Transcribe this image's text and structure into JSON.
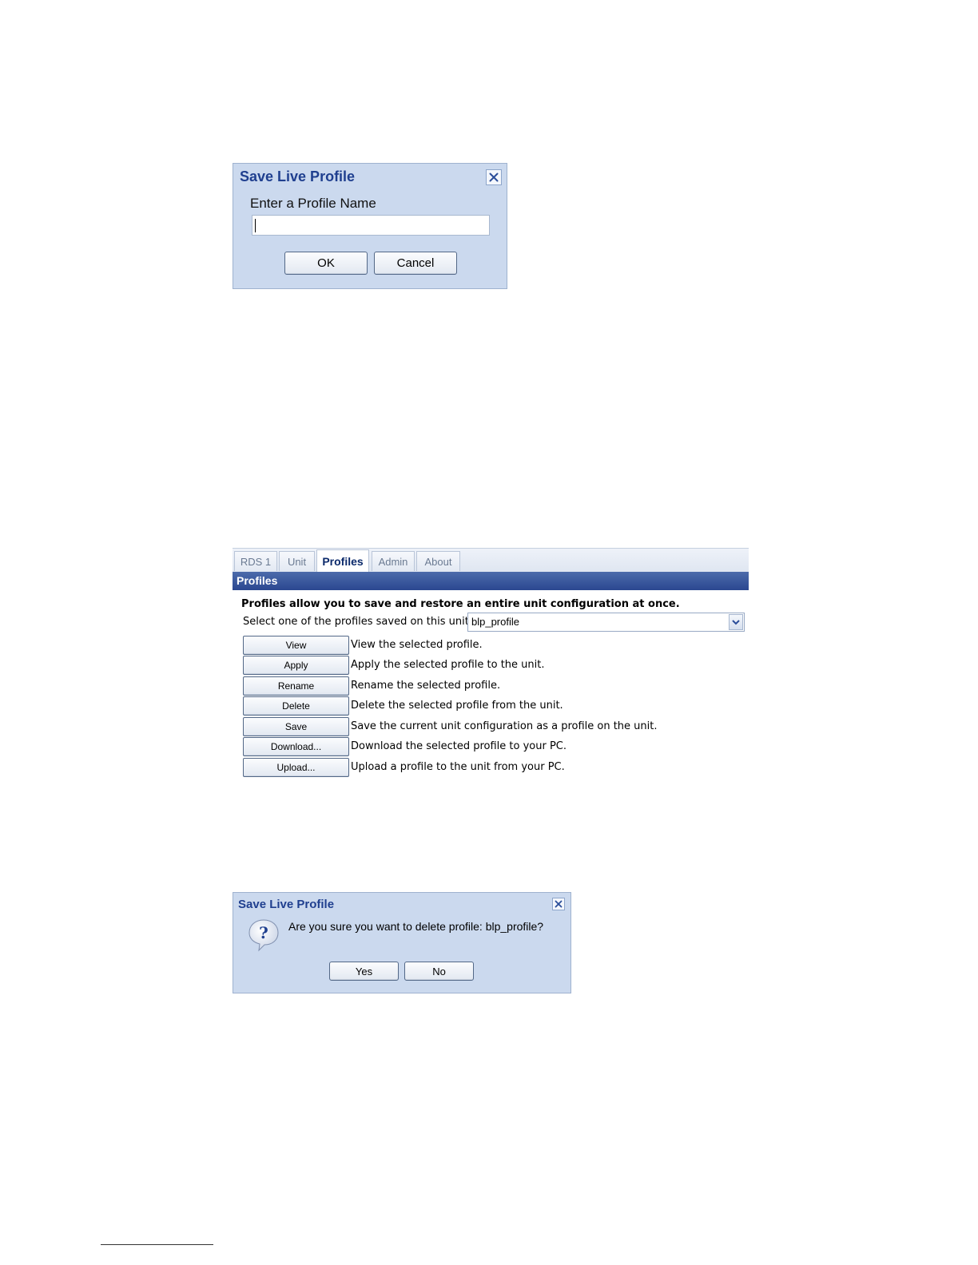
{
  "save_dialog": {
    "title": "Save Live Profile",
    "prompt": "Enter a Profile Name",
    "input_value": "",
    "ok_label": "OK",
    "cancel_label": "Cancel",
    "close_icon": "close-icon"
  },
  "profiles_panel": {
    "tabs": [
      {
        "label": "RDS 1",
        "active": false
      },
      {
        "label": "Unit",
        "active": false
      },
      {
        "label": "Profiles",
        "active": true
      },
      {
        "label": "Admin",
        "active": false
      },
      {
        "label": "About",
        "active": false
      }
    ],
    "header": "Profiles",
    "intro": "Profiles allow you to save and restore an entire unit configuration at once.",
    "select_label": "Select one of the profiles saved on this unit.",
    "selected_profile": "blp_profile",
    "actions": [
      {
        "button": "View",
        "description": "View the selected profile."
      },
      {
        "button": "Apply",
        "description": "Apply the selected profile to the unit."
      },
      {
        "button": "Rename",
        "description": "Rename the selected profile."
      },
      {
        "button": "Delete",
        "description": "Delete the selected profile from the unit."
      },
      {
        "button": "Save",
        "description": "Save the current unit configuration as a profile on the unit."
      },
      {
        "button": "Download...",
        "description": "Download the selected profile to your PC."
      },
      {
        "button": "Upload...",
        "description": "Upload a profile to the unit from your PC."
      }
    ]
  },
  "confirm_dialog": {
    "title": "Save Live Profile",
    "message": "Are you sure you want to delete profile: blp_profile?",
    "yes_label": "Yes",
    "no_label": "No",
    "icon": "question-icon"
  },
  "colors": {
    "dialog_bg": "#cbd9ee",
    "title_blue": "#1f3f8f",
    "header_blue": "#2b4790"
  }
}
